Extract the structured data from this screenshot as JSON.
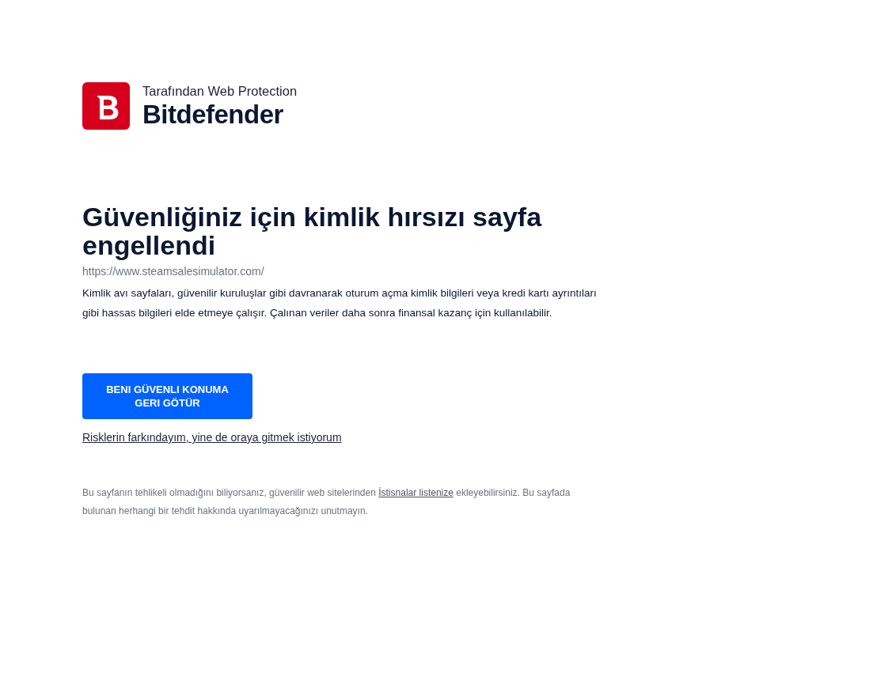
{
  "brand": {
    "subtitle": "Tarafından Web Protection",
    "name": "Bitdefender"
  },
  "warning": {
    "title": "Güvenliğiniz için kimlik hırsızı sayfa engellendi",
    "url": "https://www.steamsalesimulator.com/",
    "description": "Kimlik avı sayfaları, güvenilir kuruluşlar gibi davranarak oturum açma kimlik bilgileri veya kredi kartı ayrıntıları gibi hassas bilgileri elde etmeye çalışır. Çalınan veriler daha sonra finansal kazanç için kullanılabilir."
  },
  "actions": {
    "primary_button": "BENI GÜVENLI KONUMA GERI GÖTÜR",
    "proceed_link": "Risklerin farkındayım, yine de oraya gitmek istiyorum"
  },
  "note": {
    "before": "Bu sayfanın tehlikeli olmadığını biliyorsanız, güvenilir web sitelerinden",
    "link": "İstisnalar listenize",
    "after": "ekleyebilirsiniz. Bu sayfada bulunan herhangi bir tehdit hakkında uyarılmayacağınızı unutmayın."
  }
}
